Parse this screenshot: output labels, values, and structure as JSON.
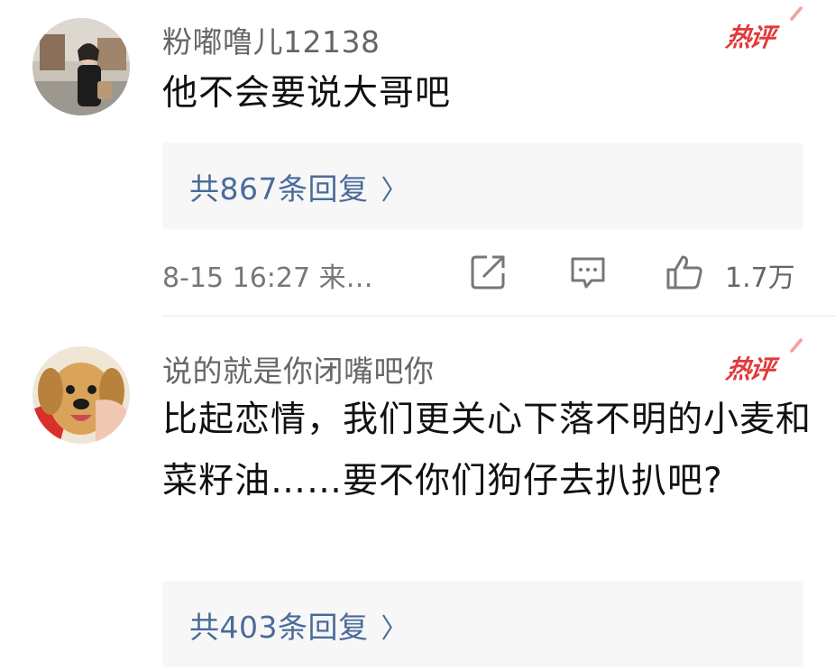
{
  "comments": [
    {
      "username": "粉嘟噜儿12138",
      "hot_badge": "热评",
      "text": "他不会要说大哥吧",
      "reply_link": "共867条回复",
      "reply_chevron": "〉",
      "time": "8-15 16:27 来…",
      "like_count": "1.7万"
    },
    {
      "username": "说的就是你闭嘴吧你",
      "hot_badge": "热评",
      "text": "比起恋情，我们更关心下落不明的小麦和菜籽油……要不你们狗仔去扒扒吧?",
      "reply_link": "共403条回复",
      "reply_chevron": "〉"
    }
  ],
  "icons": {
    "share": "share-icon",
    "comment": "comment-icon",
    "like": "thumbs-up-icon"
  },
  "colors": {
    "hot_badge": "#e03a3a",
    "reply_link": "#4a6b9a",
    "reply_box_bg": "#f7f7f7"
  }
}
